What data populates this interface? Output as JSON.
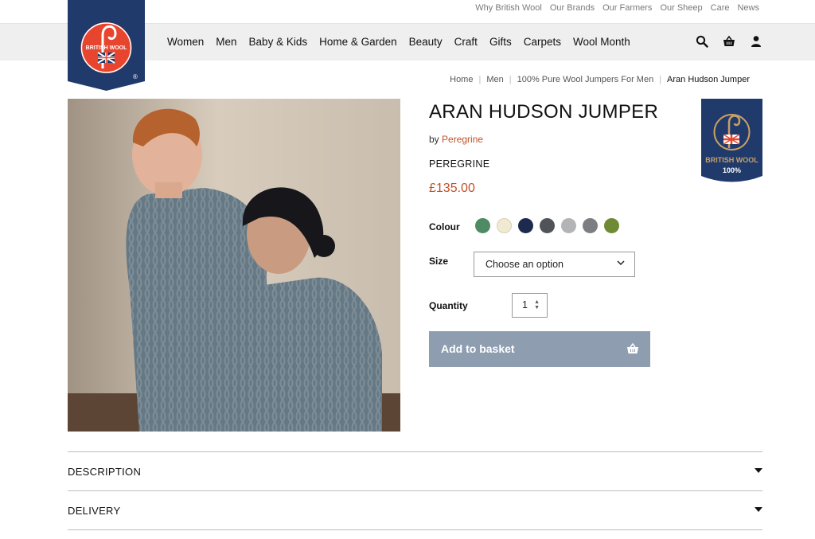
{
  "top_links": [
    "Why British Wool",
    "Our Brands",
    "Our Farmers",
    "Our Sheep",
    "Care",
    "News"
  ],
  "nav": [
    "Women",
    "Men",
    "Baby & Kids",
    "Home & Garden",
    "Beauty",
    "Craft",
    "Gifts",
    "Carpets",
    "Wool Month"
  ],
  "header_icons": [
    "search-icon",
    "basket-icon",
    "user-icon"
  ],
  "logo": {
    "text": "BRITISH WOOL",
    "registered": "®"
  },
  "breadcrumb": [
    "Home",
    "Men",
    "100% Pure Wool Jumpers For Men",
    "Aran Hudson Jumper"
  ],
  "product": {
    "title": "ARAN HUDSON JUMPER",
    "by_prefix": "by",
    "brand_link": "Peregrine",
    "brand_name": "PEREGRINE",
    "price": "£135.00"
  },
  "badge": {
    "line1": "BRITISH WOOL",
    "line2": "100%"
  },
  "options": {
    "colour_label": "Colour",
    "colours": [
      "#4e8a63",
      "#f1ead3",
      "#1d2a4d",
      "#505357",
      "#b3b4b6",
      "#7c7e82",
      "#6e8a35"
    ],
    "size_label": "Size",
    "size_value": "Choose an option",
    "quantity_label": "Quantity",
    "quantity_value": "1"
  },
  "add_to_basket": "Add to basket",
  "accordions": [
    "DESCRIPTION",
    "DELIVERY"
  ],
  "colors": {
    "accent": "#c0502a",
    "brand_navy": "#1f3a6b",
    "button": "#8e9db0"
  }
}
